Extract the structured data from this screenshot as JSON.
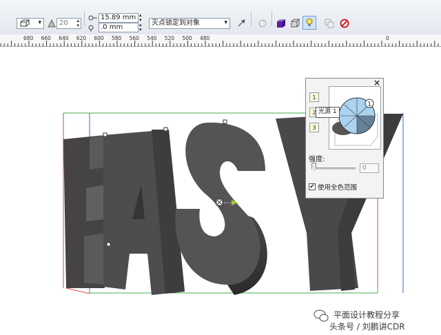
{
  "toolbar": {
    "depth_value": "20",
    "offset_x": "15.89 mm",
    "offset_y": ".0 mm",
    "vanishing_point_select": "灭点锁定到对象"
  },
  "ruler": {
    "labels": [
      "680",
      "660",
      "640",
      "620",
      "600",
      "580",
      "560",
      "540",
      "520",
      "500",
      "480",
      "0"
    ]
  },
  "lighting_panel": {
    "close": "×",
    "lights": [
      "1",
      "2",
      "3"
    ],
    "tooltip": "光源 1",
    "preview_light_marker": "1",
    "intensity_label": "强度:",
    "intensity_value": "0",
    "full_color_label": "使用全色范围",
    "full_color_checked": "✔"
  },
  "canvas": {
    "text": "EASY",
    "letter_color": "#555356",
    "guide_green": "#3fae49",
    "guide_red": "#d9454a",
    "guide_blue": "#3b63c4"
  },
  "watermark": {
    "line1": "平面设计教程分享",
    "line2": "头条号 / 刘鹏讲CDR"
  }
}
